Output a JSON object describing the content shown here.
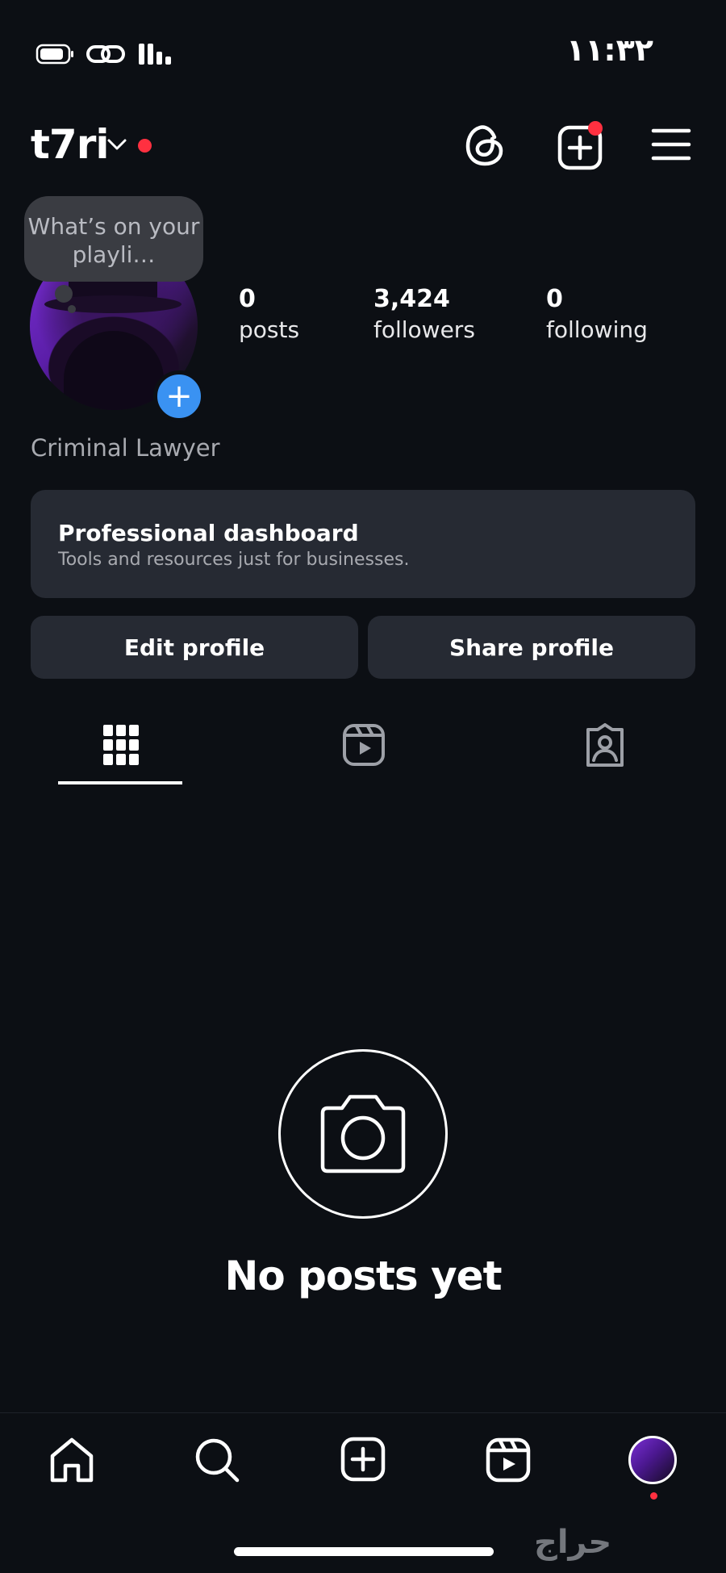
{
  "status_bar": {
    "time": "١١:٣٢"
  },
  "header": {
    "username": "t7ri"
  },
  "profile": {
    "note": "What’s on your playli…",
    "stats": [
      {
        "value": "0",
        "label": "posts"
      },
      {
        "value": "3,424",
        "label": "followers"
      },
      {
        "value": "0",
        "label": "following"
      }
    ],
    "bio": "Criminal Lawyer"
  },
  "dashboard": {
    "title": "Professional dashboard",
    "subtitle": "Tools and resources just for businesses."
  },
  "buttons": {
    "edit": "Edit profile",
    "share": "Share profile"
  },
  "tabs": {
    "icons": [
      "grid-icon",
      "reels-icon",
      "tagged-icon"
    ],
    "active": "grid-icon"
  },
  "empty_state": {
    "title": "No posts yet"
  },
  "bottom_nav": {
    "icons": [
      "home-icon",
      "search-icon",
      "create-icon",
      "reels-icon",
      "profile-avatar"
    ]
  },
  "watermark": "حراج",
  "colors": {
    "background": "#0c0f14",
    "card": "#262a33",
    "accent_blue": "#3a92f2",
    "notification_red": "#ff3040"
  }
}
